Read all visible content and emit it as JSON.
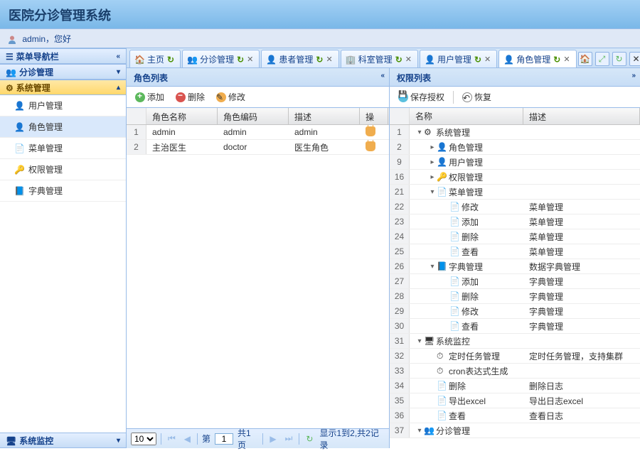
{
  "app_title": "医院分诊管理系统",
  "user_greet": "admin，您好",
  "sidebar": {
    "panels": [
      {
        "title": "菜单导航栏",
        "collapsed": true
      },
      {
        "title": "分诊管理",
        "collapsed": true
      },
      {
        "title": "系统管理",
        "collapsed": false,
        "active": true,
        "items": [
          {
            "label": "用户管理",
            "icon": "user"
          },
          {
            "label": "角色管理",
            "icon": "role",
            "selected": true
          },
          {
            "label": "菜单管理",
            "icon": "menu"
          },
          {
            "label": "权限管理",
            "icon": "perm"
          },
          {
            "label": "字典管理",
            "icon": "dict"
          }
        ]
      },
      {
        "title": "系统监控",
        "collapsed": true
      }
    ]
  },
  "tabs": [
    {
      "label": "主页",
      "icon": "home",
      "closable": false
    },
    {
      "label": "分诊管理",
      "icon": "triage",
      "closable": true
    },
    {
      "label": "患者管理",
      "icon": "patient",
      "closable": true
    },
    {
      "label": "科室管理",
      "icon": "dept",
      "closable": true
    },
    {
      "label": "用户管理",
      "icon": "user",
      "closable": true
    },
    {
      "label": "角色管理",
      "icon": "role",
      "closable": true,
      "active": true
    }
  ],
  "left_panel": {
    "title": "角色列表",
    "toolbar": {
      "add": "添加",
      "del": "删除",
      "edit": "修改"
    },
    "columns": {
      "name": "角色名称",
      "code": "角色编码",
      "desc": "描述",
      "op": "操作"
    },
    "rows": [
      {
        "num": 1,
        "name": "admin",
        "code": "admin",
        "desc": "admin"
      },
      {
        "num": 2,
        "name": "主治医生",
        "code": "doctor",
        "desc": "医生角色"
      }
    ],
    "pager": {
      "pagesize": "10",
      "page": "1",
      "pages_prefix": "第",
      "pages_suffix": "共1页",
      "info": "显示1到2,共2记录"
    }
  },
  "right_panel": {
    "title": "权限列表",
    "toolbar": {
      "save": "保存授权",
      "restore": "恢复"
    },
    "columns": {
      "name": "名称",
      "desc": "描述"
    },
    "rows": [
      {
        "num": 1,
        "indent": 0,
        "toggle": "▾",
        "icon": "gear",
        "name": "系统管理",
        "desc": ""
      },
      {
        "num": 2,
        "indent": 1,
        "toggle": "▸",
        "icon": "user",
        "name": "角色管理",
        "desc": ""
      },
      {
        "num": 9,
        "indent": 1,
        "toggle": "▸",
        "icon": "user",
        "name": "用户管理",
        "desc": ""
      },
      {
        "num": 16,
        "indent": 1,
        "toggle": "▸",
        "icon": "key",
        "name": "权限管理",
        "desc": ""
      },
      {
        "num": 21,
        "indent": 1,
        "toggle": "▾",
        "icon": "menu",
        "name": "菜单管理",
        "desc": ""
      },
      {
        "num": 22,
        "indent": 2,
        "toggle": "",
        "icon": "leaf",
        "name": "修改",
        "desc": "菜单管理"
      },
      {
        "num": 23,
        "indent": 2,
        "toggle": "",
        "icon": "leaf",
        "name": "添加",
        "desc": "菜单管理"
      },
      {
        "num": 24,
        "indent": 2,
        "toggle": "",
        "icon": "leaf",
        "name": "删除",
        "desc": "菜单管理"
      },
      {
        "num": 25,
        "indent": 2,
        "toggle": "",
        "icon": "leaf",
        "name": "查看",
        "desc": "菜单管理"
      },
      {
        "num": 26,
        "indent": 1,
        "toggle": "▾",
        "icon": "dict",
        "name": "字典管理",
        "desc": "数据字典管理"
      },
      {
        "num": 27,
        "indent": 2,
        "toggle": "",
        "icon": "leaf",
        "name": "添加",
        "desc": "字典管理"
      },
      {
        "num": 28,
        "indent": 2,
        "toggle": "",
        "icon": "leaf",
        "name": "删除",
        "desc": "字典管理"
      },
      {
        "num": 29,
        "indent": 2,
        "toggle": "",
        "icon": "leaf",
        "name": "修改",
        "desc": "字典管理"
      },
      {
        "num": 30,
        "indent": 2,
        "toggle": "",
        "icon": "leaf",
        "name": "查看",
        "desc": "字典管理"
      },
      {
        "num": 31,
        "indent": 0,
        "toggle": "▾",
        "icon": "monitor",
        "name": "系统监控",
        "desc": ""
      },
      {
        "num": 32,
        "indent": 1,
        "toggle": "",
        "icon": "clock",
        "name": "定时任务管理",
        "desc": "定时任务管理，支持集群"
      },
      {
        "num": 33,
        "indent": 1,
        "toggle": "",
        "icon": "clock",
        "name": "cron表达式生成",
        "desc": ""
      },
      {
        "num": 34,
        "indent": 1,
        "toggle": "",
        "icon": "leaf",
        "name": "删除",
        "desc": "删除日志"
      },
      {
        "num": 35,
        "indent": 1,
        "toggle": "",
        "icon": "leaf",
        "name": "导出excel",
        "desc": "导出日志excel"
      },
      {
        "num": 36,
        "indent": 1,
        "toggle": "",
        "icon": "leaf",
        "name": "查看",
        "desc": "查看日志"
      },
      {
        "num": 37,
        "indent": 0,
        "toggle": "▾",
        "icon": "triage",
        "name": "分诊管理",
        "desc": ""
      }
    ]
  }
}
